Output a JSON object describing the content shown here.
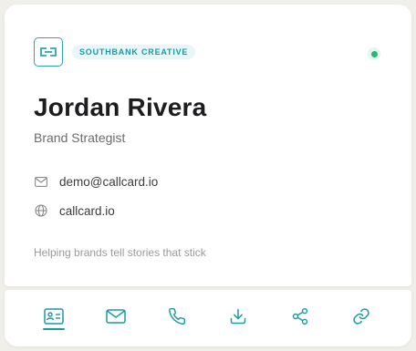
{
  "card": {
    "company": "SOUTHBANK CREATIVE",
    "name": "Jordan Rivera",
    "title": "Brand Strategist",
    "email": "demo@callcard.io",
    "website": "callcard.io",
    "tagline": "Helping brands tell stories that stick",
    "status": "online"
  },
  "toolbar": {
    "items": [
      {
        "icon": "contact-card-icon",
        "active": true
      },
      {
        "icon": "mail-icon",
        "active": false
      },
      {
        "icon": "phone-icon",
        "active": false
      },
      {
        "icon": "download-icon",
        "active": false
      },
      {
        "icon": "share-icon",
        "active": false
      },
      {
        "icon": "link-icon",
        "active": false
      }
    ]
  },
  "colors": {
    "accent": "#1a9aa6",
    "status": "#1fb97a",
    "background": "#f0efe9"
  }
}
